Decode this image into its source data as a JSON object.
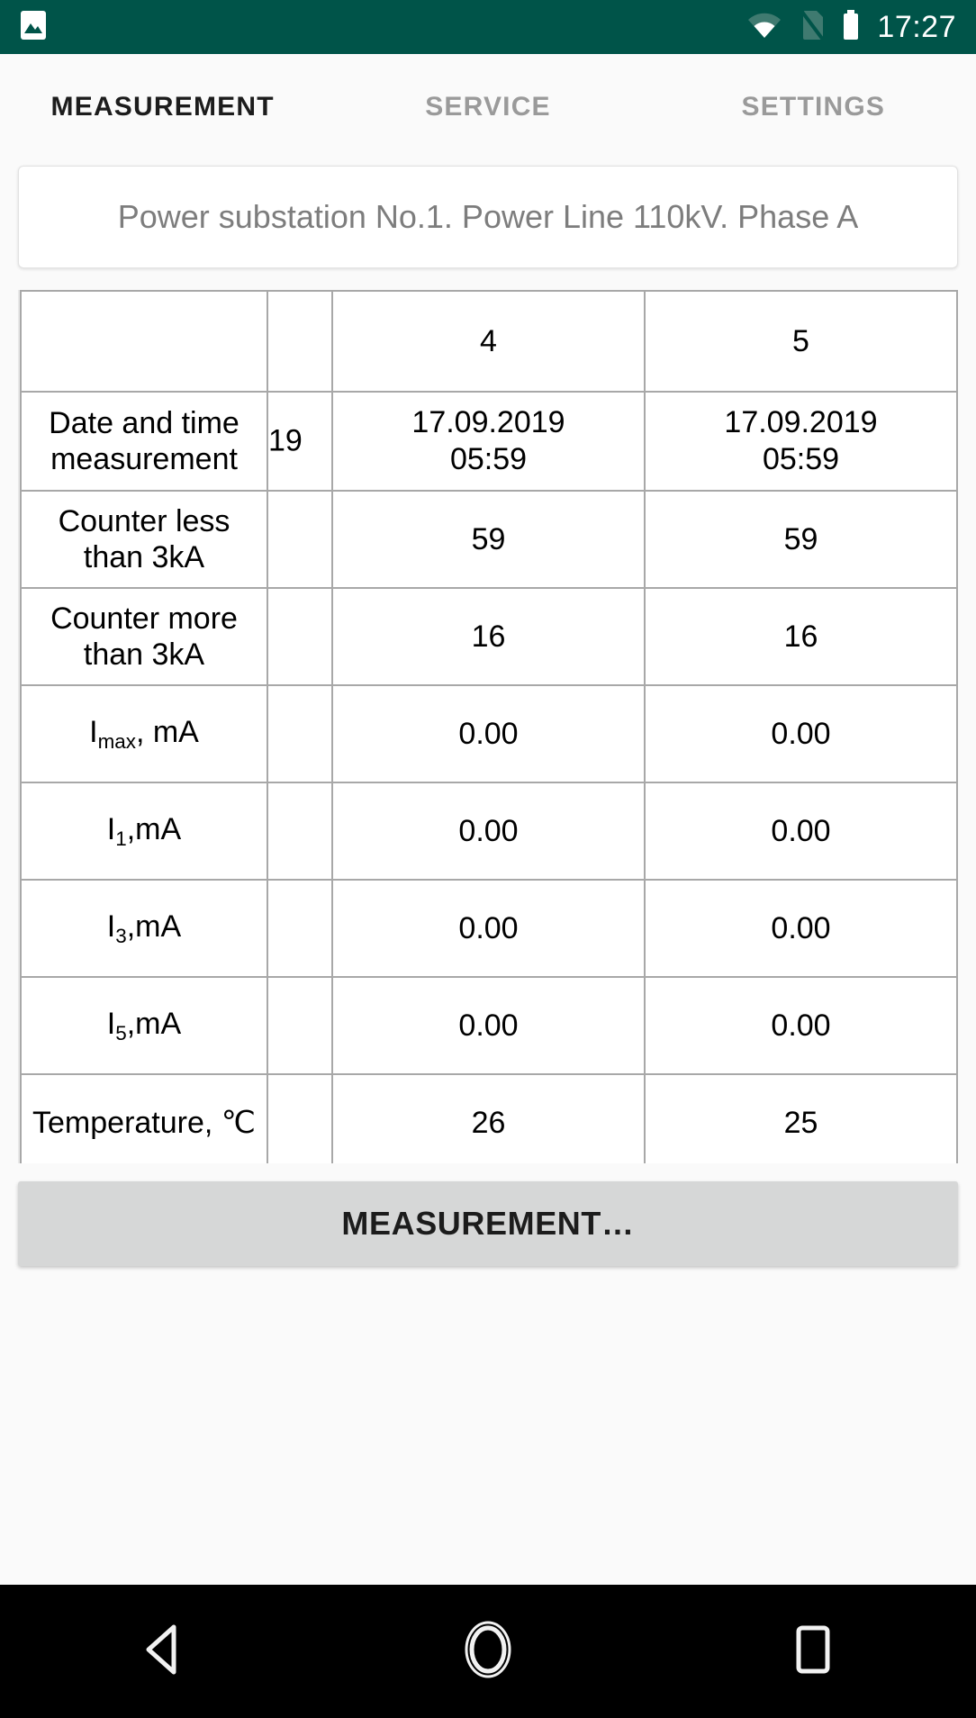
{
  "statusbar": {
    "time": "17:27",
    "icons": [
      "image-icon",
      "wifi-icon",
      "no-sim-icon",
      "battery-icon"
    ]
  },
  "tabs": [
    {
      "label": "MEASUREMENT",
      "active": true
    },
    {
      "label": "SERVICE",
      "active": false
    },
    {
      "label": "SETTINGS",
      "active": false
    }
  ],
  "title_field": {
    "value": "Power substation No.1. Power Line 110kV. Phase A",
    "placeholder": "Power substation No.1. Power Line 110kV. Phase A"
  },
  "table": {
    "columns": [
      "",
      "",
      "4",
      "5"
    ],
    "rows": [
      {
        "label": "",
        "label_html": "",
        "narrow": "",
        "v4": "4",
        "v5": "5",
        "is_header": true
      },
      {
        "label": "Date and time measurement",
        "narrow": "19",
        "v4": "17.09.2019\n05:59",
        "v5": "17.09.2019\n05:59"
      },
      {
        "label": "Counter less than 3kA",
        "narrow": "",
        "v4": "59",
        "v5": "59"
      },
      {
        "label": "Counter more than 3kA",
        "narrow": "",
        "v4": "16",
        "v5": "16"
      },
      {
        "label": "Imax, mA",
        "base": "I",
        "sub": "max",
        "tail": ", mA",
        "narrow": "",
        "v4": "0.00",
        "v5": "0.00"
      },
      {
        "label": "I1, mA",
        "base": "I",
        "sub": "1",
        "tail": ",mA",
        "narrow": "",
        "v4": "0.00",
        "v5": "0.00"
      },
      {
        "label": "I3, mA",
        "base": "I",
        "sub": "3",
        "tail": ",mA",
        "narrow": "",
        "v4": "0.00",
        "v5": "0.00"
      },
      {
        "label": "I5, mA",
        "base": "I",
        "sub": "5",
        "tail": ",mA",
        "narrow": "",
        "v4": "0.00",
        "v5": "0.00"
      },
      {
        "label": "Temperature, ℃",
        "narrow": "",
        "v4": "26",
        "v5": "25"
      }
    ],
    "cells": {
      "head_c3": "4",
      "head_c4": "5",
      "date_label_l1": "Date and time",
      "date_label_l2": "measurement",
      "date_narrow": "19",
      "date_v4_l1": "17.09.2019",
      "date_v4_l2": "05:59",
      "date_v5_l1": "17.09.2019",
      "date_v5_l2": "05:59",
      "cless_l1": "Counter less",
      "cless_l2": "than 3kA",
      "cless_v4": "59",
      "cless_v5": "59",
      "cmore_l1": "Counter more",
      "cmore_l2": "than 3kA",
      "cmore_v4": "16",
      "cmore_v5": "16",
      "imax_base": "I",
      "imax_sub": "max",
      "imax_tail": ", mA",
      "imax_v4": "0.00",
      "imax_v5": "0.00",
      "i1_base": "I",
      "i1_sub": "1",
      "i1_tail": ",mA",
      "i1_v4": "0.00",
      "i1_v5": "0.00",
      "i3_base": "I",
      "i3_sub": "3",
      "i3_tail": ",mA",
      "i3_v4": "0.00",
      "i3_v5": "0.00",
      "i5_base": "I",
      "i5_sub": "5",
      "i5_tail": ",mA",
      "i5_v4": "0.00",
      "i5_v5": "0.00",
      "temp_label": "Temperature, ℃",
      "temp_v4": "26",
      "temp_v5": "25"
    }
  },
  "action_button": {
    "label": "MEASUREMENT…"
  },
  "navbar": {
    "back": "back-icon",
    "home": "home-icon",
    "recents": "recents-icon"
  },
  "colors": {
    "status_bar": "#005449",
    "page_bg": "#fafafa",
    "table_border": "#a8a8a8",
    "button_bg": "#d6d7d7",
    "tab_active": "#1c1c1c",
    "tab_inactive": "#9a9a9a",
    "field_text": "#7d7d7d",
    "navbar_bg": "#000000"
  }
}
